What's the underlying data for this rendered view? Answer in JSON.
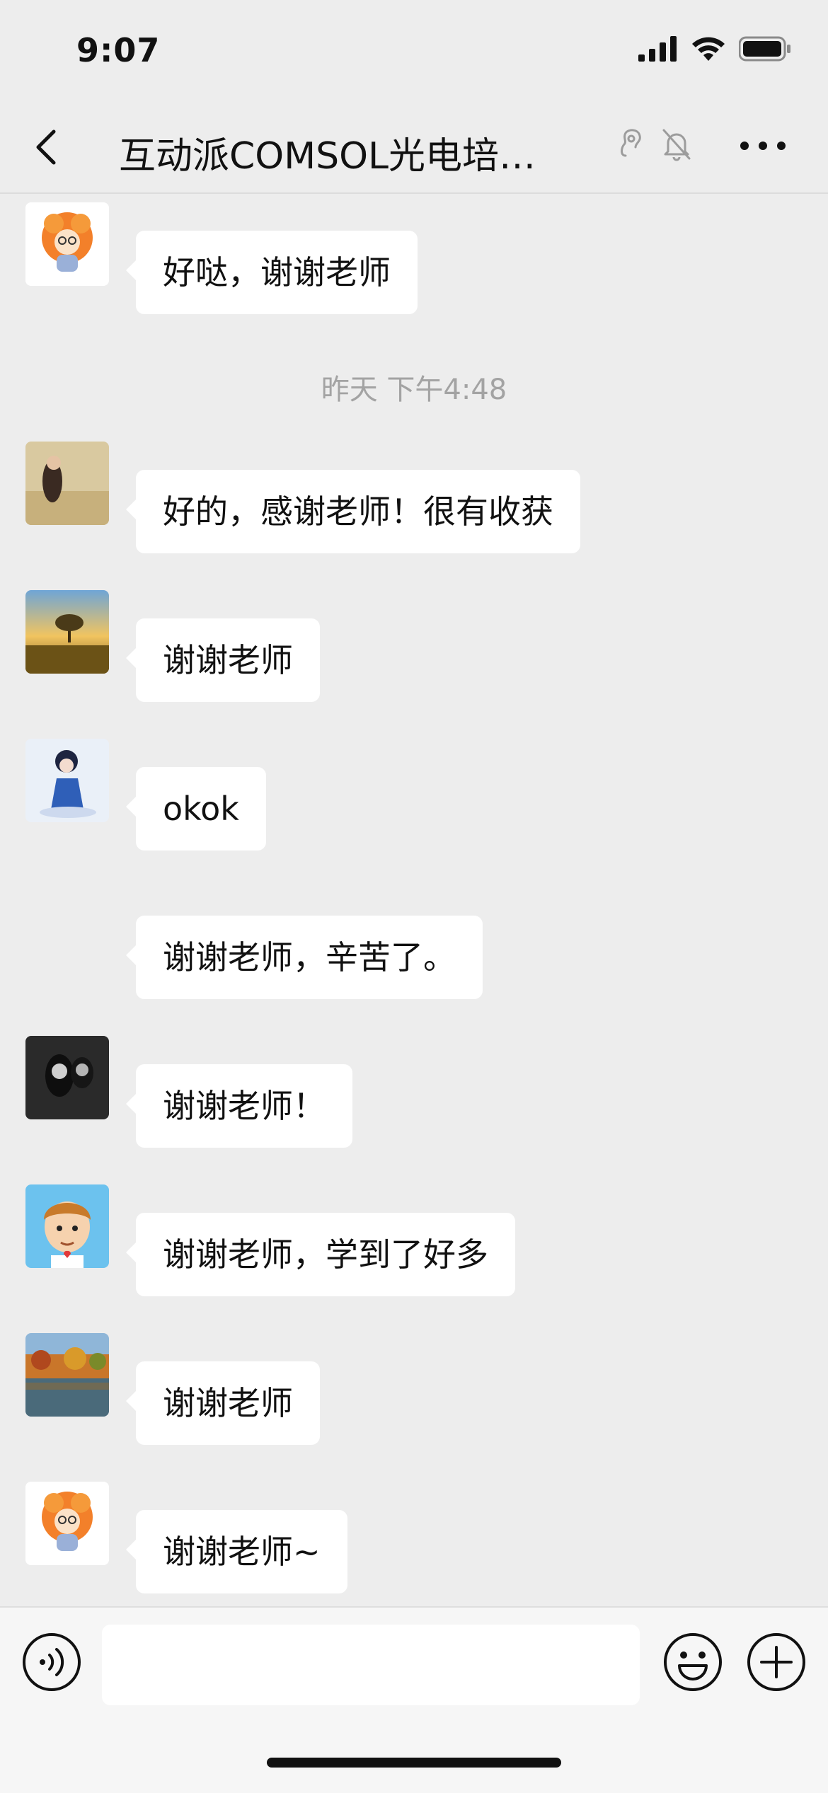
{
  "status_bar": {
    "time": "9:07"
  },
  "nav": {
    "title": "互动派COMSOL光电培…"
  },
  "chat": {
    "timestamp": "昨天 下午4:48",
    "messages": [
      {
        "text": "好哒，谢谢老师",
        "avatar": "orange-hair-cartoon-avatar"
      },
      {
        "text": "好的，感谢老师！很有收获",
        "avatar": "girl-in-field-avatar"
      },
      {
        "text": "谢谢老师",
        "avatar": "sunset-tree-avatar"
      },
      {
        "text": "okok",
        "avatar": "anime-figure-avatar"
      },
      {
        "text": "谢谢老师，辛苦了。",
        "avatar": "blank-avatar"
      },
      {
        "text": "谢谢老师！",
        "avatar": "black-white-couple-avatar"
      },
      {
        "text": "谢谢老师，学到了好多",
        "avatar": "cartoon-boy-avatar"
      },
      {
        "text": "谢谢老师",
        "avatar": "autumn-lake-avatar"
      },
      {
        "text": "谢谢老师~",
        "avatar": "orange-hair-cartoon-avatar"
      }
    ]
  },
  "input": {
    "value": "",
    "placeholder": ""
  },
  "colors": {
    "background": "#ededed",
    "bubble": "#ffffff",
    "timestamp": "#a3a3a3"
  }
}
